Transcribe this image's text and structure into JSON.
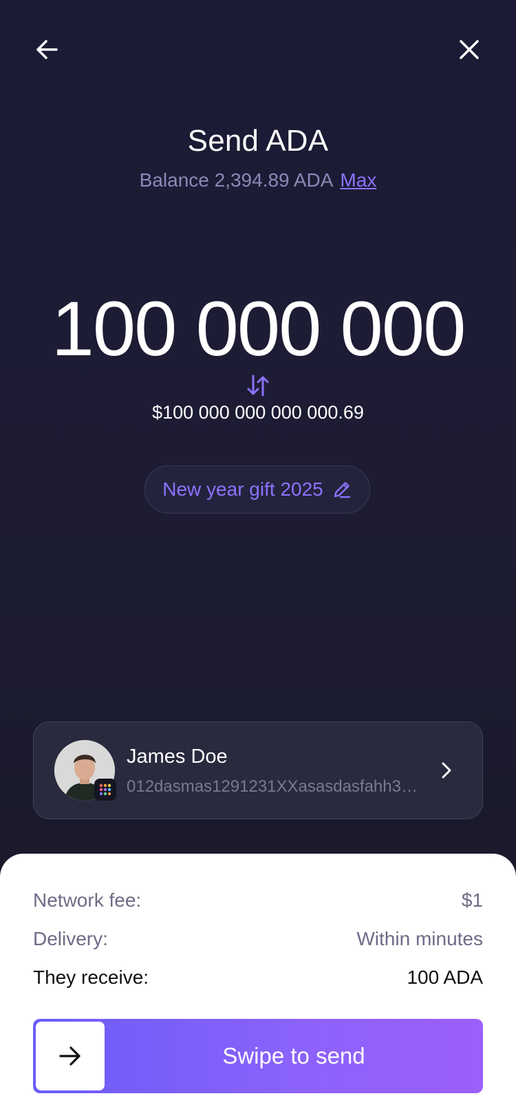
{
  "header": {
    "back_icon": "arrow-left-icon",
    "close_icon": "close-icon",
    "title": "Send ADA",
    "balance_text": "Balance 2,394.89 ADA",
    "max_label": "Max"
  },
  "amount": {
    "value": "100 000 000",
    "swap_icon": "swap-vertical-icon",
    "fiat_value": "$100 000 000 000 000.69"
  },
  "note": {
    "text": "New year gift 2025",
    "icon": "pencil-icon"
  },
  "recipient": {
    "name": "James Doe",
    "address": "012dasmas1291231XXasasdasfahh33...",
    "avatar_icon": "avatar",
    "badge_icon": "wallet-app-icon",
    "chevron_icon": "chevron-right-icon"
  },
  "summary": {
    "fee_label": "Network fee:",
    "fee_value": "$1",
    "delivery_label": "Delivery:",
    "delivery_value": "Within minutes",
    "receive_label": "They receive:",
    "receive_value": "100 ADA"
  },
  "swipe": {
    "label": "Swipe to send",
    "handle_icon": "arrow-right-icon"
  },
  "colors": {
    "accent": "#8b73ff",
    "background": "#1c1b36",
    "swipe_start": "#6a5cf8",
    "swipe_end": "#9c5ffb"
  }
}
